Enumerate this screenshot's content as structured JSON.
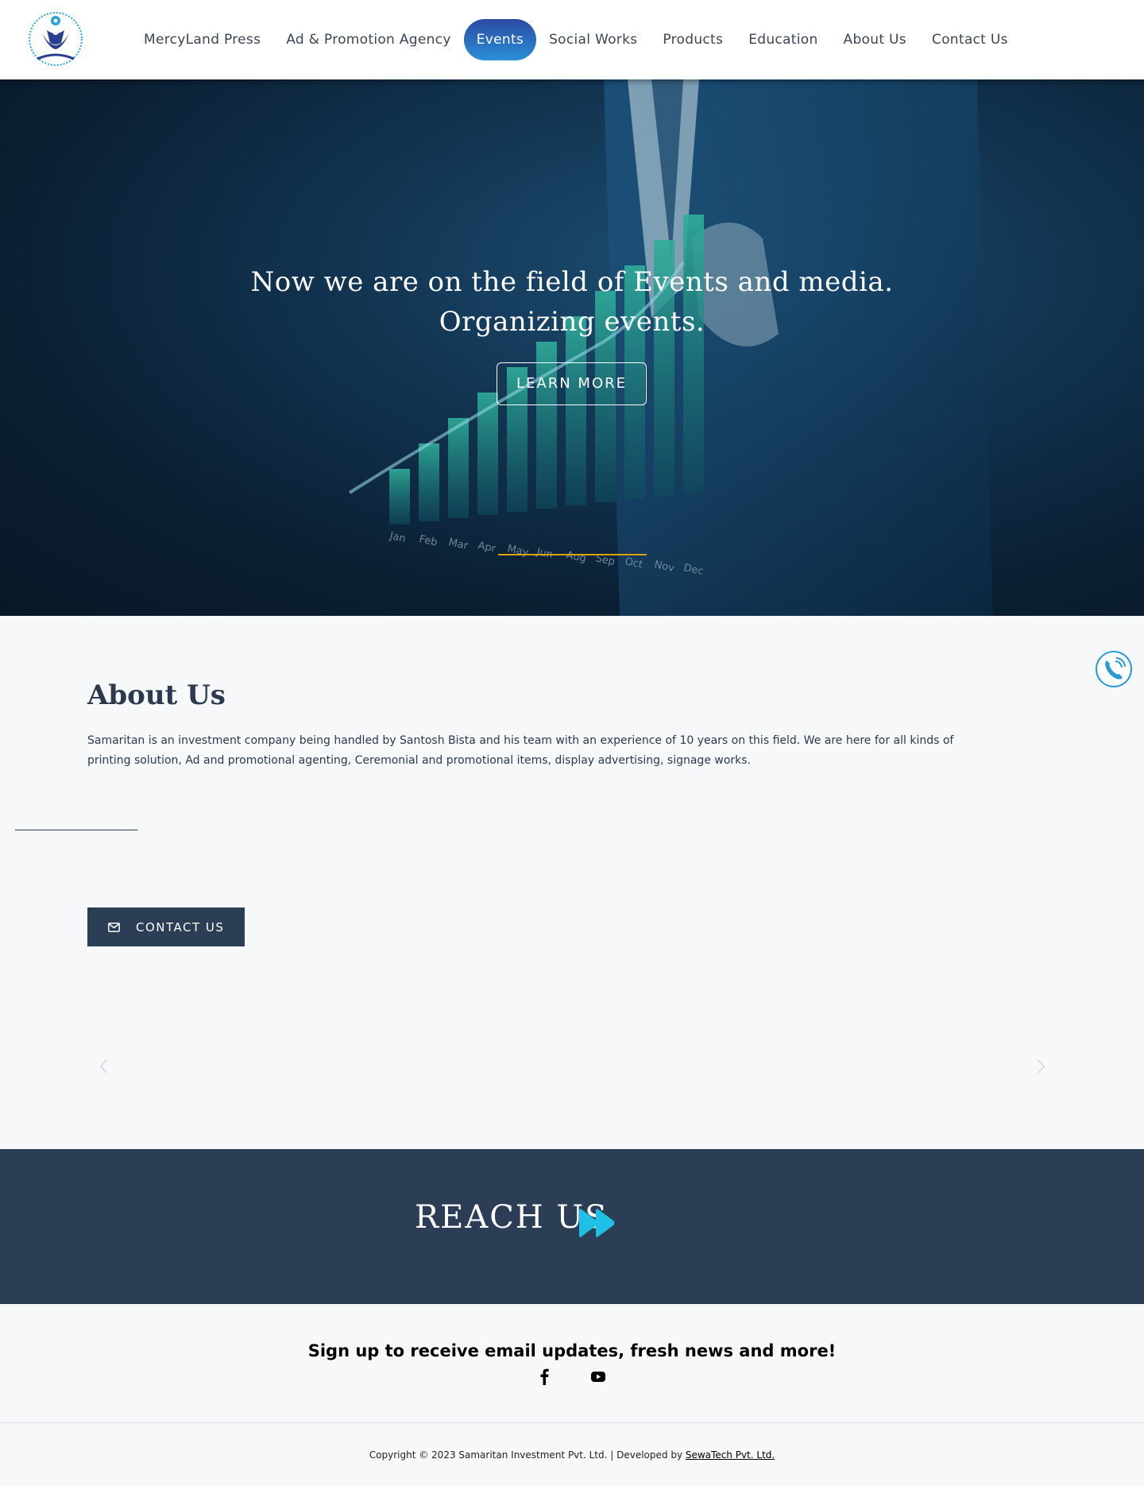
{
  "nav": {
    "items": [
      {
        "label": "MercyLand Press"
      },
      {
        "label": "Ad & Promotion Agency"
      },
      {
        "label": "Events"
      },
      {
        "label": "Social Works"
      },
      {
        "label": "Products"
      },
      {
        "label": "Education"
      },
      {
        "label": "About Us"
      },
      {
        "label": "Contact Us"
      }
    ],
    "active_index": 2,
    "active_colors": [
      "#2b4aa0",
      "#2a8fd8"
    ]
  },
  "hero": {
    "line1": "Now we are on the field of Events and media.",
    "line2": "Organizing events.",
    "button_label": "LEARN MORE",
    "slider_indicator_color": "#e0a010",
    "chart_months": [
      "Jan",
      "Feb",
      "Mar",
      "Apr",
      "May",
      "Jun",
      "Aug",
      "Sep",
      "Oct",
      "Nov",
      "Dec"
    ]
  },
  "about": {
    "title": "About Us",
    "text": "Samaritan is an investment company being handled by Santosh Bista and his team with an experience of 10 years on this field. We are here for all kinds of printing solution, Ad and promotional agenting, Ceremonial and promotional items, display advertising, signage works.",
    "contact_button": "CONTACT US",
    "contact_icon": "envelope-icon"
  },
  "reach": {
    "title": "REACH US",
    "icon": "fast-forward-icon",
    "icon_color": "#1ec0e6",
    "background": "#2c3e55"
  },
  "signup": {
    "text": "Sign up to receive email updates, fresh news and more!",
    "social": [
      "facebook-icon",
      "youtube-icon"
    ]
  },
  "footer": {
    "copyright": "Copyright © 2023 Samaritan Investment Pvt. Ltd. | Developed by ",
    "developer": "SewaTech Pvt. Ltd."
  }
}
